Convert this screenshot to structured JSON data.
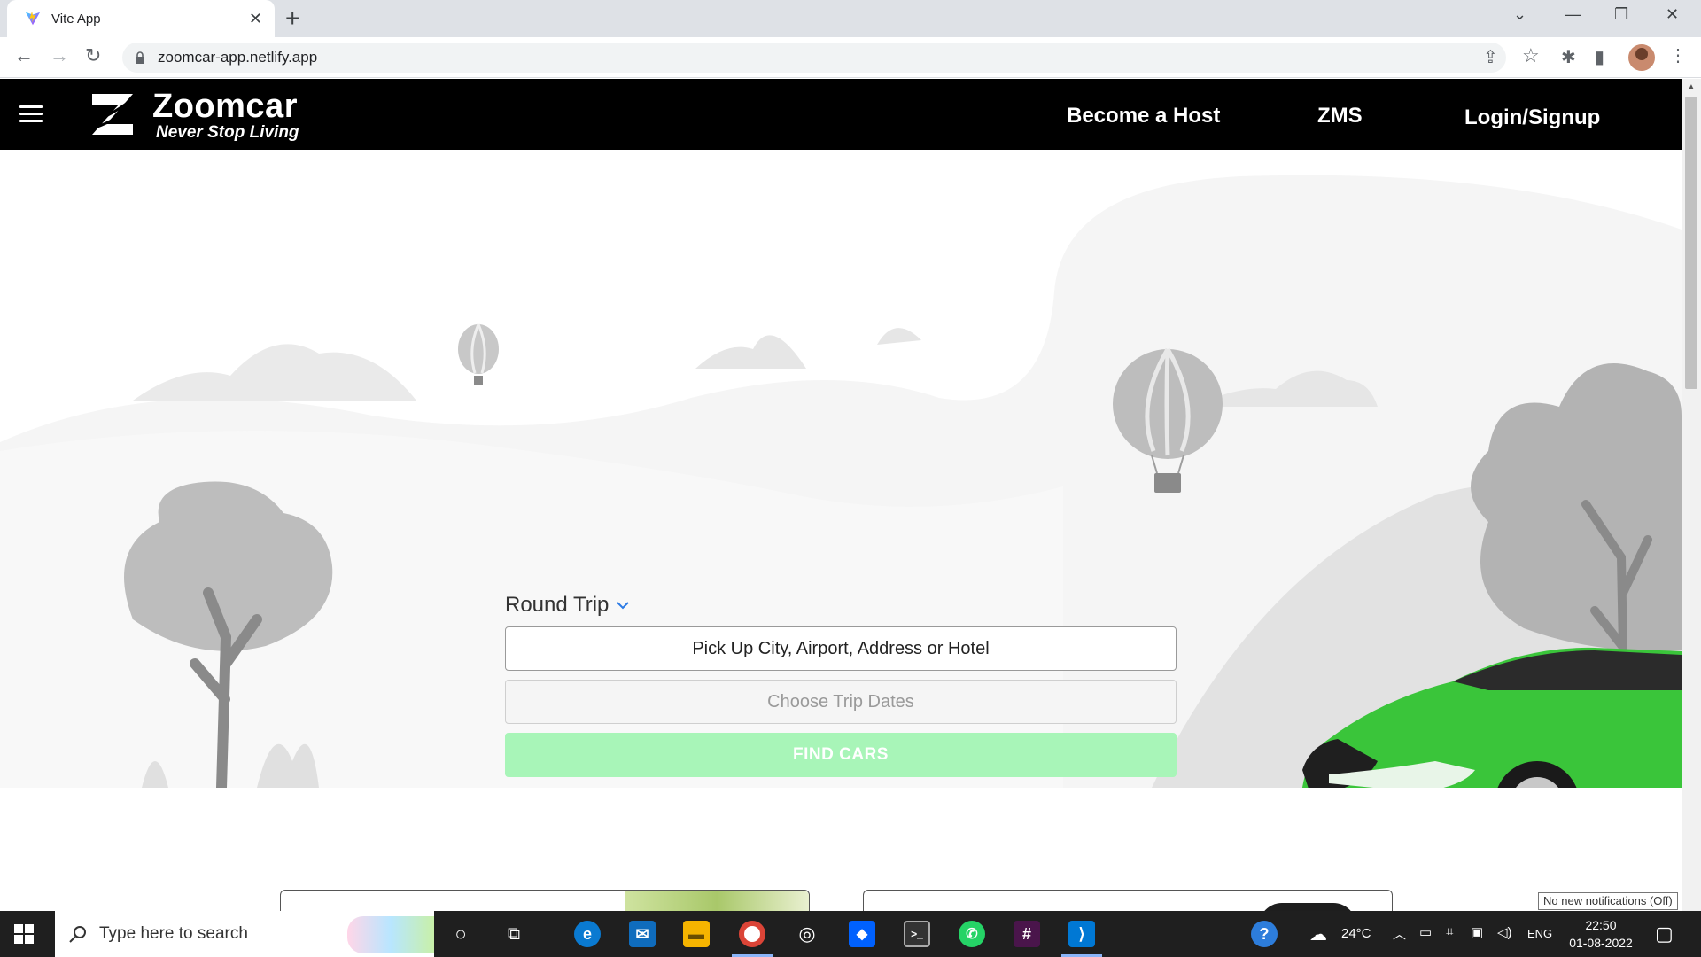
{
  "browser": {
    "tab_title": "Vite App",
    "url": "zoomcar-app.netlify.app"
  },
  "site": {
    "logo_name": "Zoomcar",
    "logo_tagline": "Never Stop Living",
    "nav": {
      "become_host": "Become a Host",
      "zms": "ZMS",
      "login": "Login/Signup"
    },
    "search": {
      "trip_type": "Round Trip",
      "pickup_placeholder": "Pick Up City, Airport, Address or Hotel",
      "dates_placeholder": "Choose Trip Dates",
      "find_button": "FIND CARS"
    },
    "accent_color": "#22c55e",
    "find_button_color": "#a8f5b8"
  },
  "notification_tooltip": "No new notifications (Off)",
  "taskbar": {
    "search_placeholder": "Type here to search",
    "weather": "24°C",
    "language": "ENG",
    "time": "22:50",
    "date": "01-08-2022"
  }
}
